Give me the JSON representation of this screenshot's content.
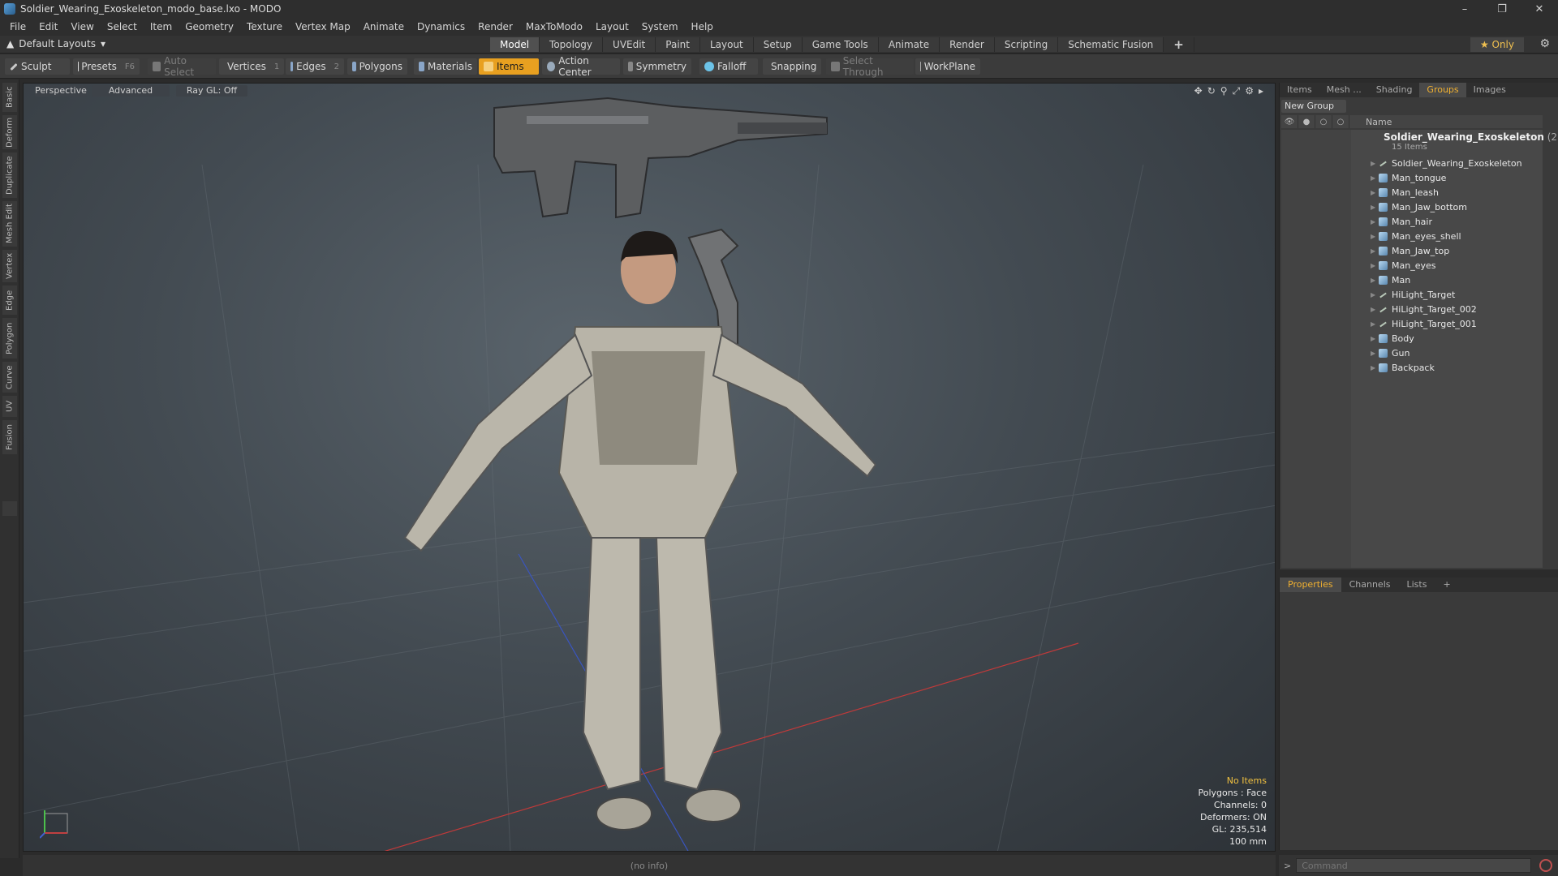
{
  "window": {
    "title": "Soldier_Wearing_Exoskeleton_modo_base.lxo - MODO",
    "controls": [
      "–",
      "❐",
      "✕"
    ]
  },
  "menu": [
    "File",
    "Edit",
    "View",
    "Select",
    "Item",
    "Geometry",
    "Texture",
    "Vertex Map",
    "Animate",
    "Dynamics",
    "Render",
    "MaxToModo",
    "Layout",
    "System",
    "Help"
  ],
  "layout_bar": {
    "layout_select": "Default Layouts",
    "tabs": [
      "Model",
      "Topology",
      "UVEdit",
      "Paint",
      "Layout",
      "Setup",
      "Game Tools",
      "Animate",
      "Render",
      "Scripting",
      "Schematic Fusion"
    ],
    "active_tab": "Model",
    "add_tab": "+",
    "only_label": "★  Only"
  },
  "toolbar": {
    "sculpt": "Sculpt",
    "presets": "Presets",
    "presets_key": "F6",
    "auto_select": "Auto Select",
    "vertices": "Vertices",
    "vertices_key": "1",
    "edges": "Edges",
    "edges_key": "2",
    "polygons": "Polygons",
    "materials": "Materials",
    "items": "Items",
    "action_center": "Action Center",
    "symmetry": "Symmetry",
    "falloff": "Falloff",
    "snapping": "Snapping",
    "select_through": "Select Through",
    "workplane": "WorkPlane"
  },
  "left_tabs": [
    "Basic",
    "Deform",
    "Duplicate",
    "Mesh Edit",
    "Vertex",
    "Edge",
    "Polygon",
    "Curve",
    "UV",
    "Fusion"
  ],
  "viewport": {
    "view_mode": "Perspective",
    "shading": "Advanced",
    "raygl": "Ray GL: Off",
    "info": {
      "selection": "No Items",
      "polygons": "Polygons : Face",
      "channels": "Channels: 0",
      "deformers": "Deformers: ON",
      "gl": "GL: 235,514",
      "scale": "100 mm"
    }
  },
  "right_panel": {
    "tabs": [
      "Items",
      "Mesh ...",
      "Shading",
      "Groups",
      "Images"
    ],
    "active_tab": "Groups",
    "new_group": "New Group",
    "column_name": "Name",
    "group": {
      "name": "Soldier_Wearing_Exoskeleton",
      "name_suffix": " (2...",
      "count": "15 Items",
      "items": [
        {
          "name": "Soldier_Wearing_Exoskeleton",
          "type": "locator-icon"
        },
        {
          "name": "Man_tongue",
          "type": "mesh-icon"
        },
        {
          "name": "Man_leash",
          "type": "mesh-icon"
        },
        {
          "name": "Man_Jaw_bottom",
          "type": "mesh-icon"
        },
        {
          "name": "Man_hair",
          "type": "mesh-icon"
        },
        {
          "name": "Man_eyes_shell",
          "type": "mesh-icon"
        },
        {
          "name": "Man_Jaw_top",
          "type": "mesh-icon"
        },
        {
          "name": "Man_eyes",
          "type": "mesh-icon"
        },
        {
          "name": "Man",
          "type": "mesh-icon"
        },
        {
          "name": "HiLight_Target",
          "type": "locator-icon"
        },
        {
          "name": "HiLight_Target_002",
          "type": "locator-icon"
        },
        {
          "name": "HiLight_Target_001",
          "type": "locator-icon"
        },
        {
          "name": "Body",
          "type": "mesh-icon"
        },
        {
          "name": "Gun",
          "type": "mesh-icon"
        },
        {
          "name": "Backpack",
          "type": "mesh-icon"
        }
      ]
    }
  },
  "properties_panel": {
    "tabs": [
      "Properties",
      "Channels",
      "Lists",
      "+"
    ],
    "active_tab": "Properties"
  },
  "status_bar": {
    "info": "(no info)"
  },
  "command": {
    "prompt": ">",
    "placeholder": "Command"
  },
  "colors": {
    "accent": "#e8a020",
    "selection": "#f0c040",
    "panel": "#3a3a3a"
  }
}
